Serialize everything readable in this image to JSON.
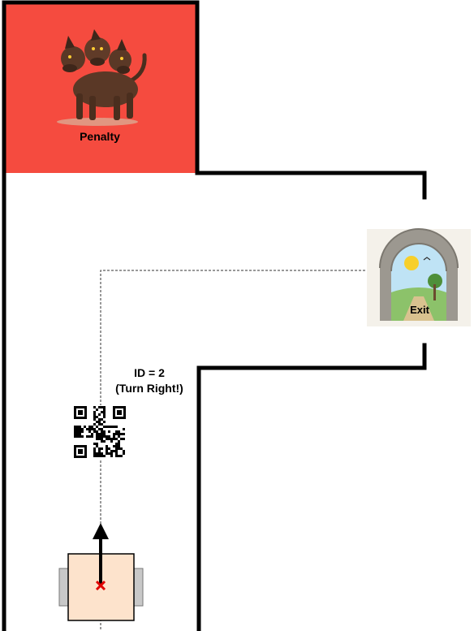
{
  "zones": {
    "penalty": {
      "label": "Penalty",
      "icon": "three-headed-dog-icon",
      "color": "#f54b3f"
    },
    "exit": {
      "label": "Exit",
      "icon": "stone-archway-icon"
    }
  },
  "marker": {
    "id_text": "ID = 2",
    "instruction": "(Turn Right!)",
    "icon": "qr-code-icon"
  },
  "robot": {
    "icon": "robot-top-view-icon",
    "body_color": "#fde3cc",
    "wheel_color": "#c8c8c8",
    "marker_color": "#e00000"
  },
  "colors": {
    "walls": "#000000",
    "path": "#333333"
  }
}
